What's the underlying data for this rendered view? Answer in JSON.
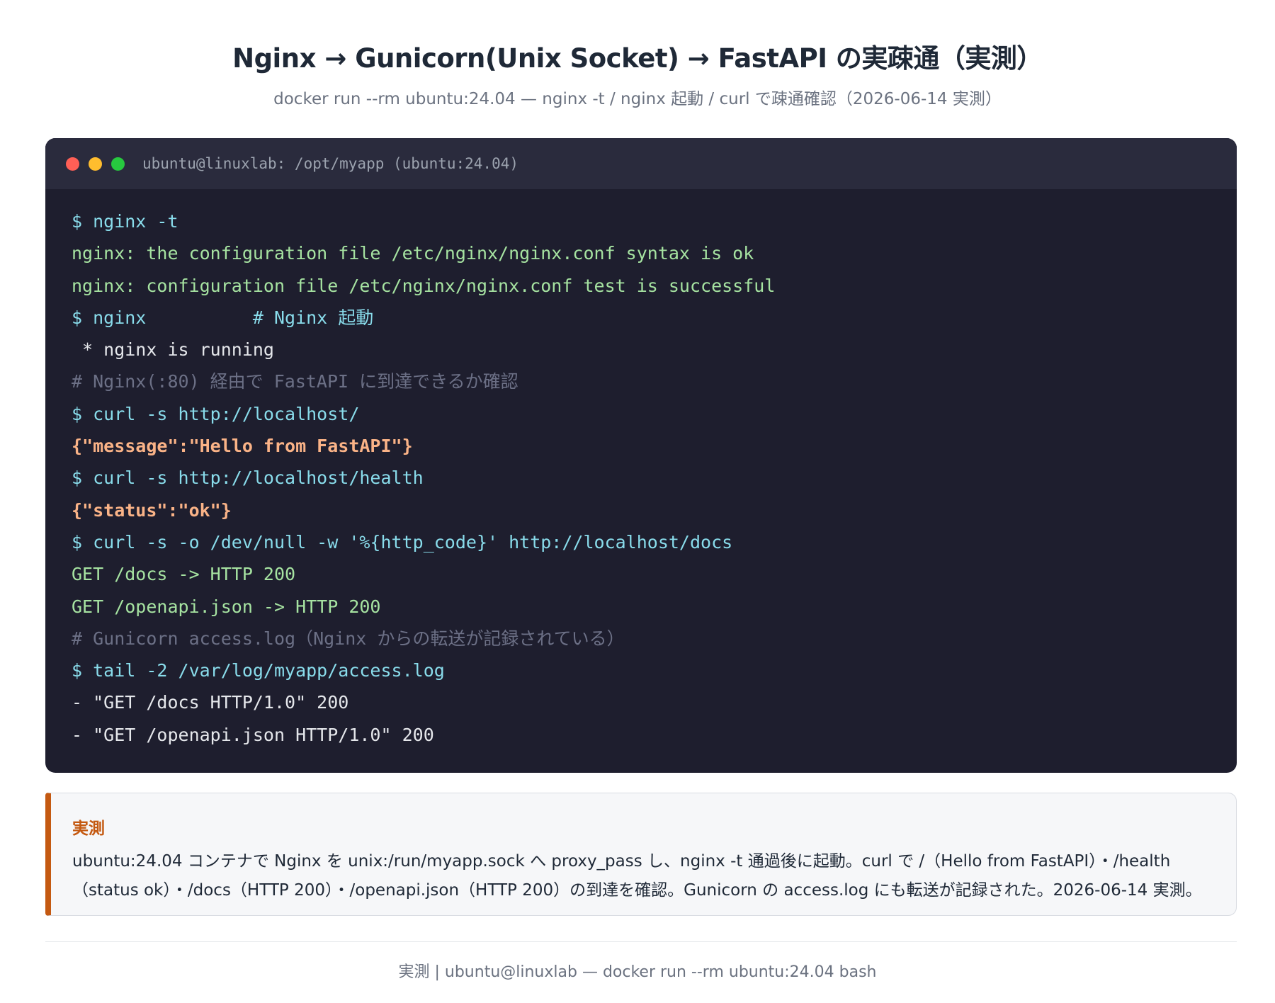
{
  "header": {
    "title": "Nginx → Gunicorn(Unix Socket) → FastAPI の実疎通（実測）",
    "subtitle": "docker run --rm ubuntu:24.04 — nginx -t / nginx 起動 / curl で疎通確認（2026-06-14 実測）"
  },
  "terminal": {
    "title": "ubuntu@linuxlab: /opt/myapp (ubuntu:24.04)",
    "lines": [
      {
        "kind": "cmd",
        "text": "$ nginx -t"
      },
      {
        "kind": "out-green",
        "text": "nginx: the configuration file /etc/nginx/nginx.conf syntax is ok"
      },
      {
        "kind": "out-green",
        "text": "nginx: configuration file /etc/nginx/nginx.conf test is successful"
      },
      {
        "kind": "cmd",
        "text": "$ nginx          # Nginx 起動"
      },
      {
        "kind": "out-white",
        "text": " * nginx is running"
      },
      {
        "kind": "comment",
        "text": "# Nginx(:80) 経由で FastAPI に到達できるか確認"
      },
      {
        "kind": "cmd",
        "text": "$ curl -s http://localhost/"
      },
      {
        "kind": "json",
        "text": "{\"message\":\"Hello from FastAPI\"}"
      },
      {
        "kind": "cmd",
        "text": "$ curl -s http://localhost/health"
      },
      {
        "kind": "json",
        "text": "{\"status\":\"ok\"}"
      },
      {
        "kind": "cmd",
        "text": "$ curl -s -o /dev/null -w '%{http_code}' http://localhost/docs"
      },
      {
        "kind": "out-green",
        "text": "GET /docs -> HTTP 200"
      },
      {
        "kind": "out-green",
        "text": "GET /openapi.json -> HTTP 200"
      },
      {
        "kind": "comment",
        "text": "# Gunicorn access.log（Nginx からの転送が記録されている）"
      },
      {
        "kind": "cmd",
        "text": "$ tail -2 /var/log/myapp/access.log"
      },
      {
        "kind": "out-white",
        "text": "- \"GET /docs HTTP/1.0\" 200"
      },
      {
        "kind": "out-white",
        "text": "- \"GET /openapi.json HTTP/1.0\" 200"
      }
    ]
  },
  "note": {
    "title": "実測",
    "body": "ubuntu:24.04 コンテナで Nginx を unix:/run/myapp.sock へ proxy_pass し、nginx -t 通過後に起動。curl で /（Hello from FastAPI）・/health（status ok）・/docs（HTTP 200）・/openapi.json（HTTP 200）の到達を確認。Gunicorn の access.log にも転送が記録された。2026-06-14 実測。"
  },
  "footer": {
    "text": "実測 | ubuntu@linuxlab — docker run --rm ubuntu:24.04 bash"
  },
  "colors": {
    "accent": "#c45911",
    "terminal_bg": "#1e1e2e",
    "command": "#89dceb",
    "output_green": "#a6e3a1",
    "json_output": "#fab387",
    "comment": "#6c7086"
  }
}
